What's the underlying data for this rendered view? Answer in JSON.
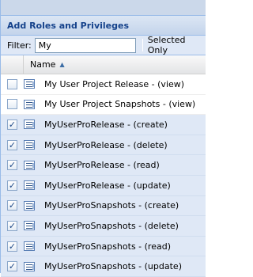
{
  "panel": {
    "title": "Add Roles and Privileges"
  },
  "filter": {
    "label": "Filter:",
    "value": "My",
    "selected_only_label": "Selected Only"
  },
  "grid": {
    "column_name": "Name",
    "rows": [
      {
        "name": "My User Project Release - (view)",
        "checked": false
      },
      {
        "name": "My User Project Snapshots - (view)",
        "checked": false
      },
      {
        "name": "MyUserProRelease - (create)",
        "checked": true
      },
      {
        "name": "MyUserProRelease - (delete)",
        "checked": true
      },
      {
        "name": "MyUserProRelease - (read)",
        "checked": true
      },
      {
        "name": "MyUserProRelease - (update)",
        "checked": true
      },
      {
        "name": "MyUserProSnapshots - (create)",
        "checked": true
      },
      {
        "name": "MyUserProSnapshots - (delete)",
        "checked": true
      },
      {
        "name": "MyUserProSnapshots - (read)",
        "checked": true
      },
      {
        "name": "MyUserProSnapshots - (update)",
        "checked": true
      }
    ]
  },
  "colors": {
    "header_text": "#15428b",
    "selected_row": "#dfe8f6",
    "border": "#99bbe8"
  },
  "icons": {
    "role": "role-icon",
    "sort": "sort-ascending-icon",
    "check": "checkbox-icon"
  }
}
